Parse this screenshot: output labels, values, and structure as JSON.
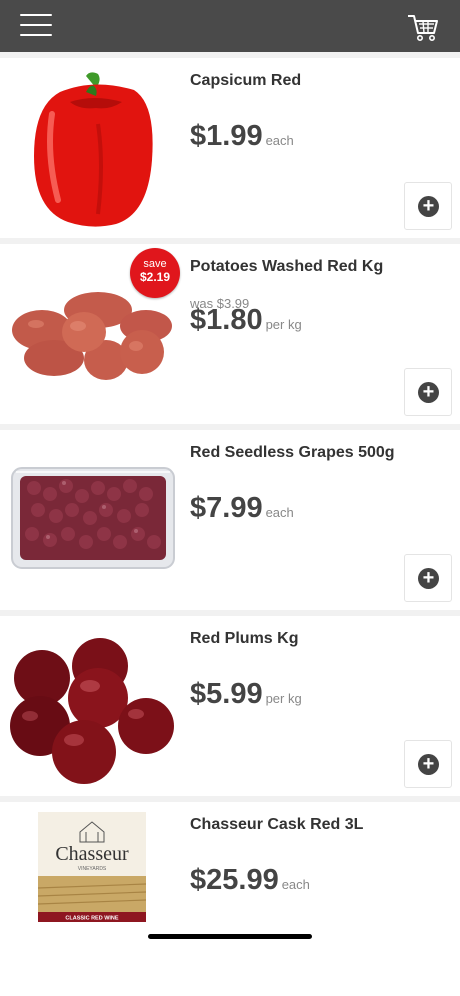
{
  "header": {
    "menu_icon": "hamburger-menu-icon",
    "cart_icon": "shopping-cart-icon",
    "bg_color": "#4a4a4a"
  },
  "products": [
    {
      "name": "Capsicum Red",
      "price": "$1.99",
      "unit": "each"
    },
    {
      "name": "Potatoes Washed Red Kg",
      "was": "was $3.99",
      "price": "$1.80",
      "unit": "per kg",
      "badge": {
        "line1": "save",
        "line2": "$2.19"
      }
    },
    {
      "name": "Red Seedless Grapes 500g",
      "price": "$7.99",
      "unit": "each"
    },
    {
      "name": "Red Plums Kg",
      "price": "$5.99",
      "unit": "per kg"
    },
    {
      "name": "Chasseur Cask Red 3L",
      "price": "$25.99",
      "unit": "each",
      "image_text": {
        "brand": "Chasseur",
        "sub": "VINEYARDS",
        "label": "CLASSIC RED WINE"
      }
    }
  ],
  "colors": {
    "badge_red": "#e0161c",
    "price_text": "#444444"
  }
}
